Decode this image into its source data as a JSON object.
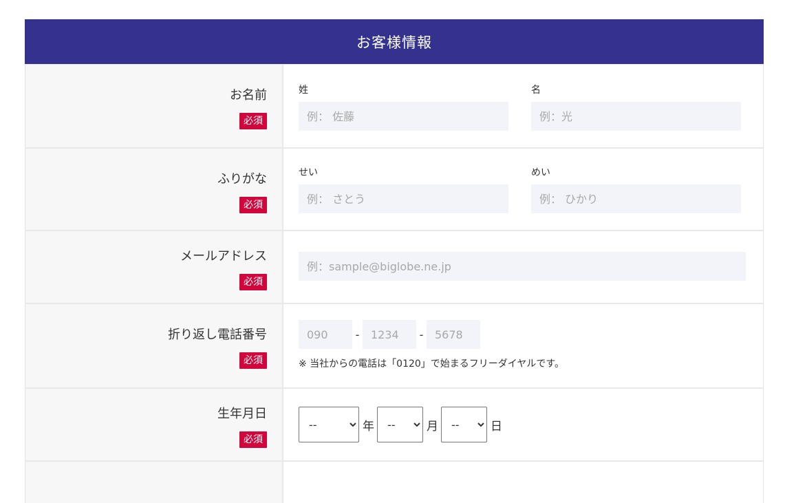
{
  "form": {
    "title": "お客様情報",
    "required_badge": "必須",
    "name": {
      "label": "お名前",
      "last_label": "姓",
      "last_placeholder": "例： 佐藤",
      "first_label": "名",
      "first_placeholder": "例：光"
    },
    "furigana": {
      "label": "ふりがな",
      "last_label": "せい",
      "last_placeholder": "例： さとう",
      "first_label": "めい",
      "first_placeholder": "例： ひかり"
    },
    "email": {
      "label": "メールアドレス",
      "placeholder": "例：sample@biglobe.ne.jp"
    },
    "phone": {
      "label": "折り返し電話番号",
      "part1_placeholder": "090",
      "part2_placeholder": "1234",
      "part3_placeholder": "5678",
      "separator": "-",
      "note": "※ 当社からの電話は「0120」で始まるフリーダイヤルです。"
    },
    "birthdate": {
      "label": "生年月日",
      "year_value": "--",
      "year_unit": "年",
      "month_value": "--",
      "month_unit": "月",
      "day_value": "--",
      "day_unit": "日"
    }
  }
}
